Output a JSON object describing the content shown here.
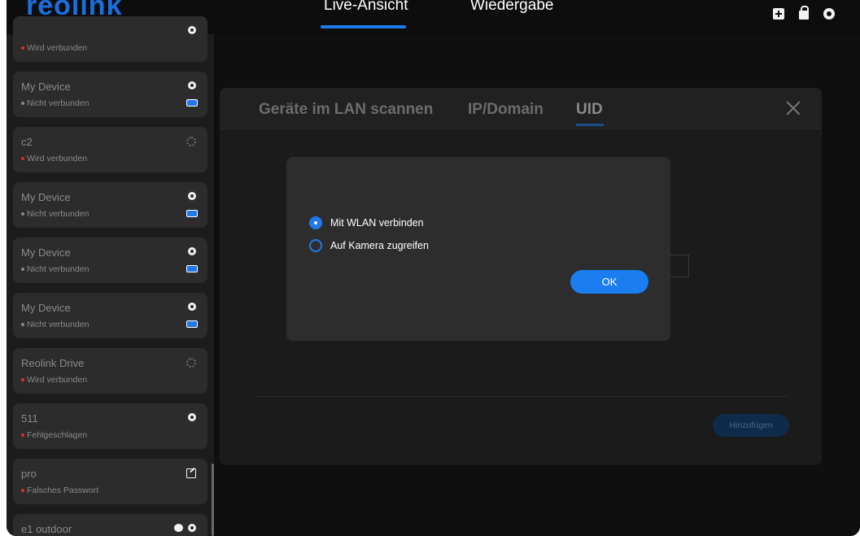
{
  "app": {
    "logo_text": "reolink"
  },
  "nav": {
    "tabs": [
      {
        "label": "Live-Ansicht",
        "active": true
      },
      {
        "label": "Wiedergabe",
        "active": false
      }
    ]
  },
  "toolbar_icons": [
    "add-device-icon",
    "lock-icon",
    "settings-gear-icon"
  ],
  "devices": [
    {
      "name": "",
      "status": "Wird verbunden",
      "status_color": "#e02c2c",
      "icons": [
        "power-icon"
      ]
    },
    {
      "name": "My Device",
      "status": "Nicht verbunden",
      "status_color": "#8a8a8a",
      "icons": [
        "power-icon",
        "battery-icon"
      ]
    },
    {
      "name": "c2",
      "status": "Wird verbunden",
      "status_color": "#e02c2c",
      "icons": [
        "loading-spinner-icon"
      ]
    },
    {
      "name": "My Device",
      "status": "Nicht verbunden",
      "status_color": "#8a8a8a",
      "icons": [
        "power-icon",
        "battery-icon"
      ]
    },
    {
      "name": "My Device",
      "status": "Nicht verbunden",
      "status_color": "#8a8a8a",
      "icons": [
        "power-icon",
        "battery-icon"
      ]
    },
    {
      "name": "My Device",
      "status": "Nicht verbunden",
      "status_color": "#8a8a8a",
      "icons": [
        "power-icon",
        "battery-icon"
      ]
    },
    {
      "name": "Reolink Drive",
      "status": "Wird verbunden",
      "status_color": "#e02c2c",
      "icons": [
        "loading-spinner-icon"
      ]
    },
    {
      "name": "511",
      "status": "Fehlgeschlagen",
      "status_color": "#e02c2c",
      "icons": [
        "power-icon"
      ]
    },
    {
      "name": "pro",
      "status": "Falsches Passwort",
      "status_color": "#e02c2c",
      "icons": [
        "edit-icon"
      ]
    },
    {
      "name": "e1 outdoor",
      "status": "",
      "status_color": "#8a8a8a",
      "icons": [
        "cloud-icon",
        "power-icon"
      ]
    }
  ],
  "add_panel": {
    "tabs": [
      {
        "label": "Geräte im LAN scannen"
      },
      {
        "label": "IP/Domain"
      },
      {
        "label": "UID",
        "active": true
      }
    ],
    "add_button": "Hinzufügen"
  },
  "dialog": {
    "options": [
      {
        "label": "Mit WLAN verbinden",
        "selected": true
      },
      {
        "label": "Auf Kamera zugreifen",
        "selected": false
      }
    ],
    "ok_label": "OK"
  },
  "colors": {
    "accent": "#1f7ae8",
    "error": "#e02c2c",
    "background": "#0f0f0f"
  }
}
